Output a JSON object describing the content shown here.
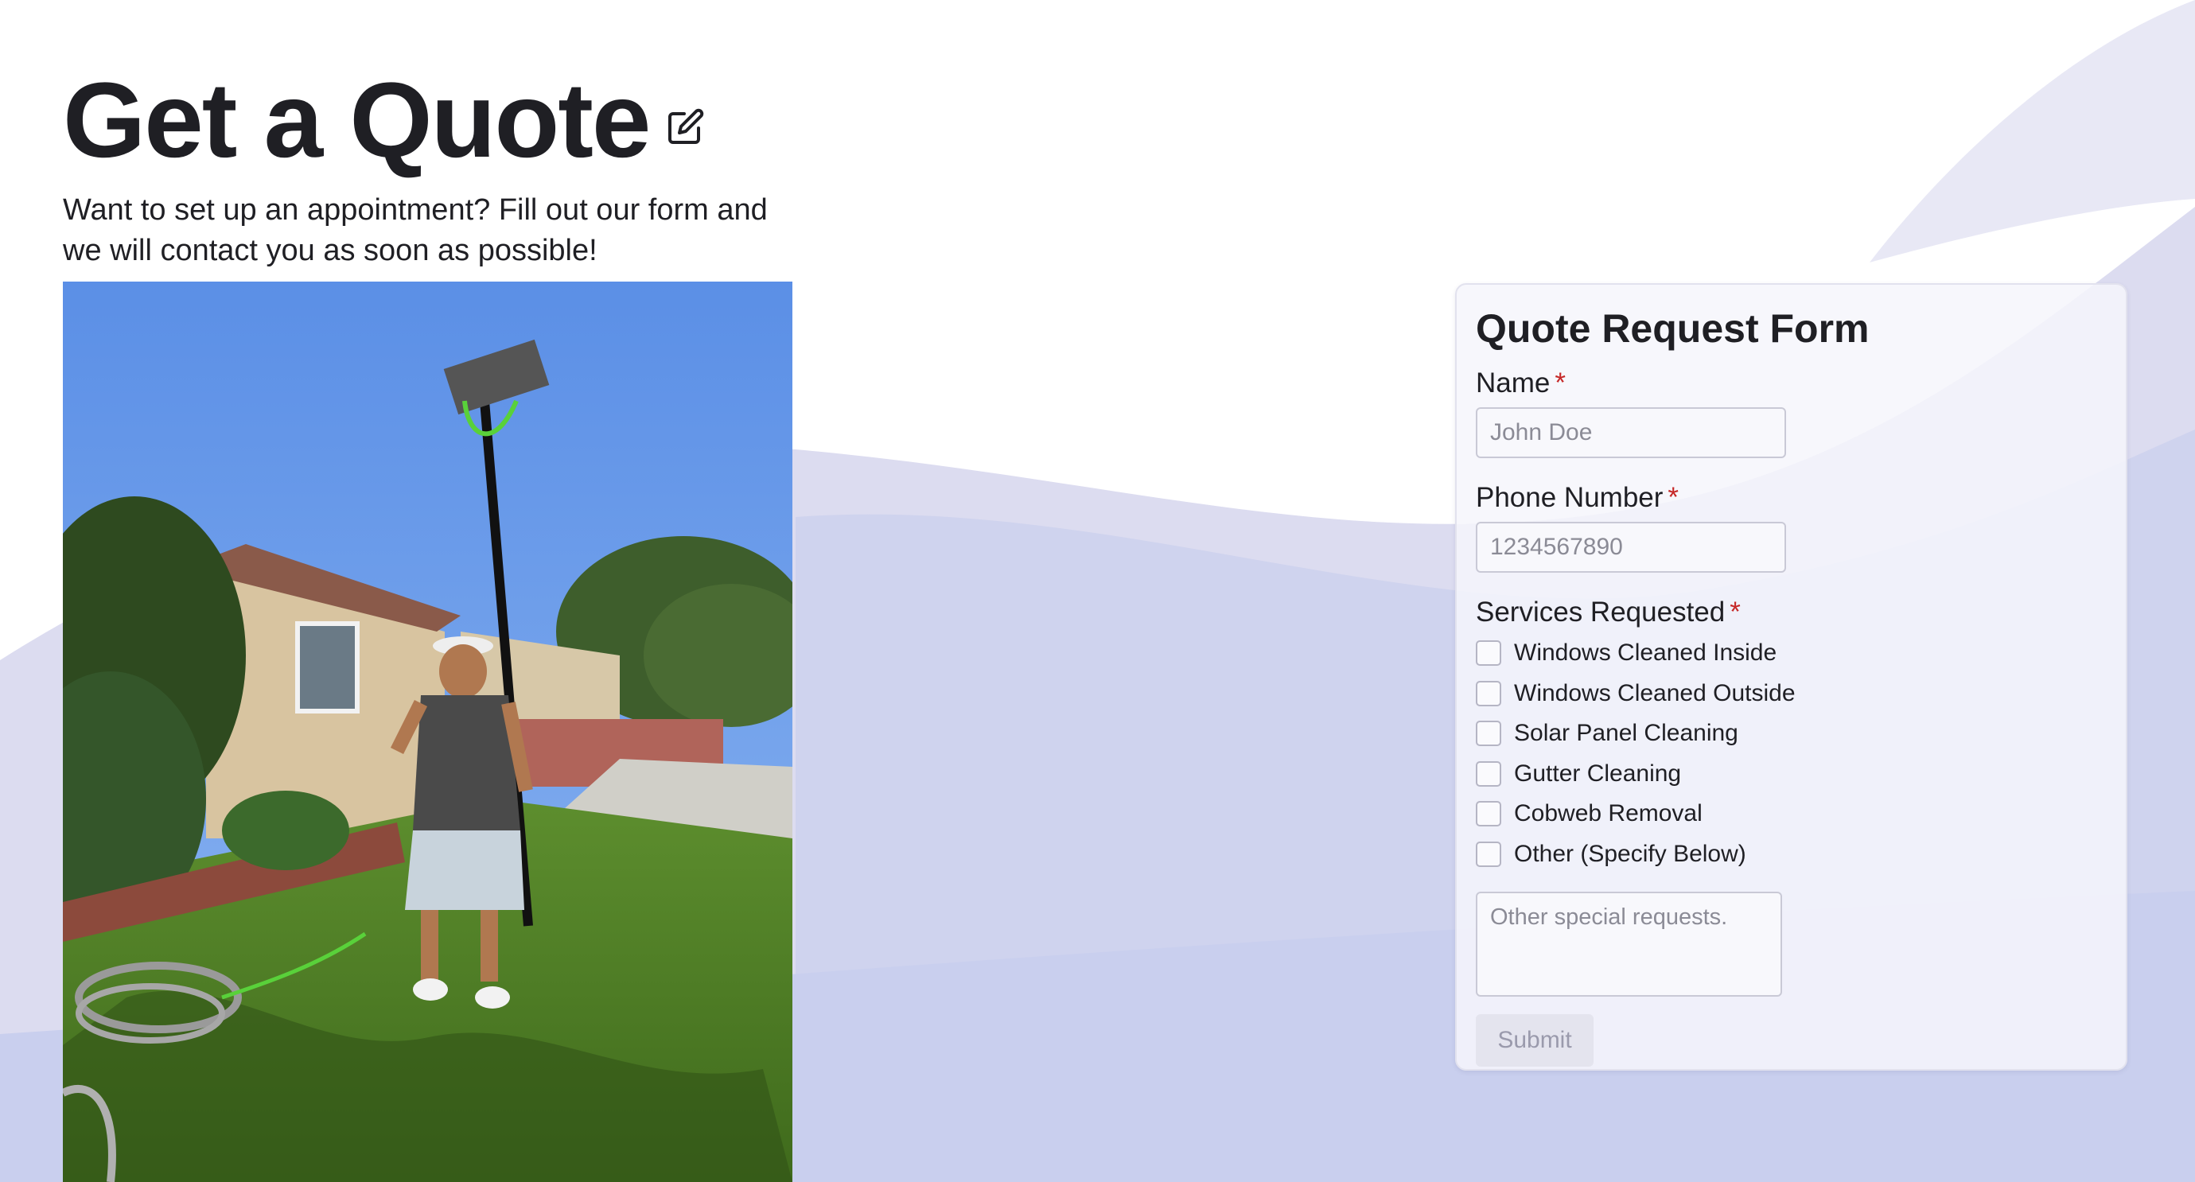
{
  "header": {
    "title": "Get a Quote",
    "edit_icon": "edit-icon",
    "subtitle": "Want to set up an appointment? Fill out our form and we will contact you as soon as possible!"
  },
  "photo": {
    "description_icon": "photo"
  },
  "form": {
    "title": "Quote Request Form",
    "required_marker": "*",
    "name_label": "Name",
    "name_placeholder": "John Doe",
    "name_value": "",
    "phone_label": "Phone Number",
    "phone_placeholder": "1234567890",
    "phone_value": "",
    "services_label": "Services Requested",
    "services": [
      {
        "label": "Windows Cleaned Inside",
        "checked": false
      },
      {
        "label": "Windows Cleaned Outside",
        "checked": false
      },
      {
        "label": "Solar Panel Cleaning",
        "checked": false
      },
      {
        "label": "Gutter Cleaning",
        "checked": false
      },
      {
        "label": "Cobweb Removal",
        "checked": false
      },
      {
        "label": "Other (Specify Below)",
        "checked": false
      }
    ],
    "other_placeholder": "Other special requests.",
    "submit_label": "Submit"
  },
  "colors": {
    "wave_light": "#e5e4f3",
    "wave_mid": "#d4d6ef",
    "wave_deep": "#c7cdec",
    "required": "#c62828",
    "submit_bg": "#e4e4ee"
  }
}
